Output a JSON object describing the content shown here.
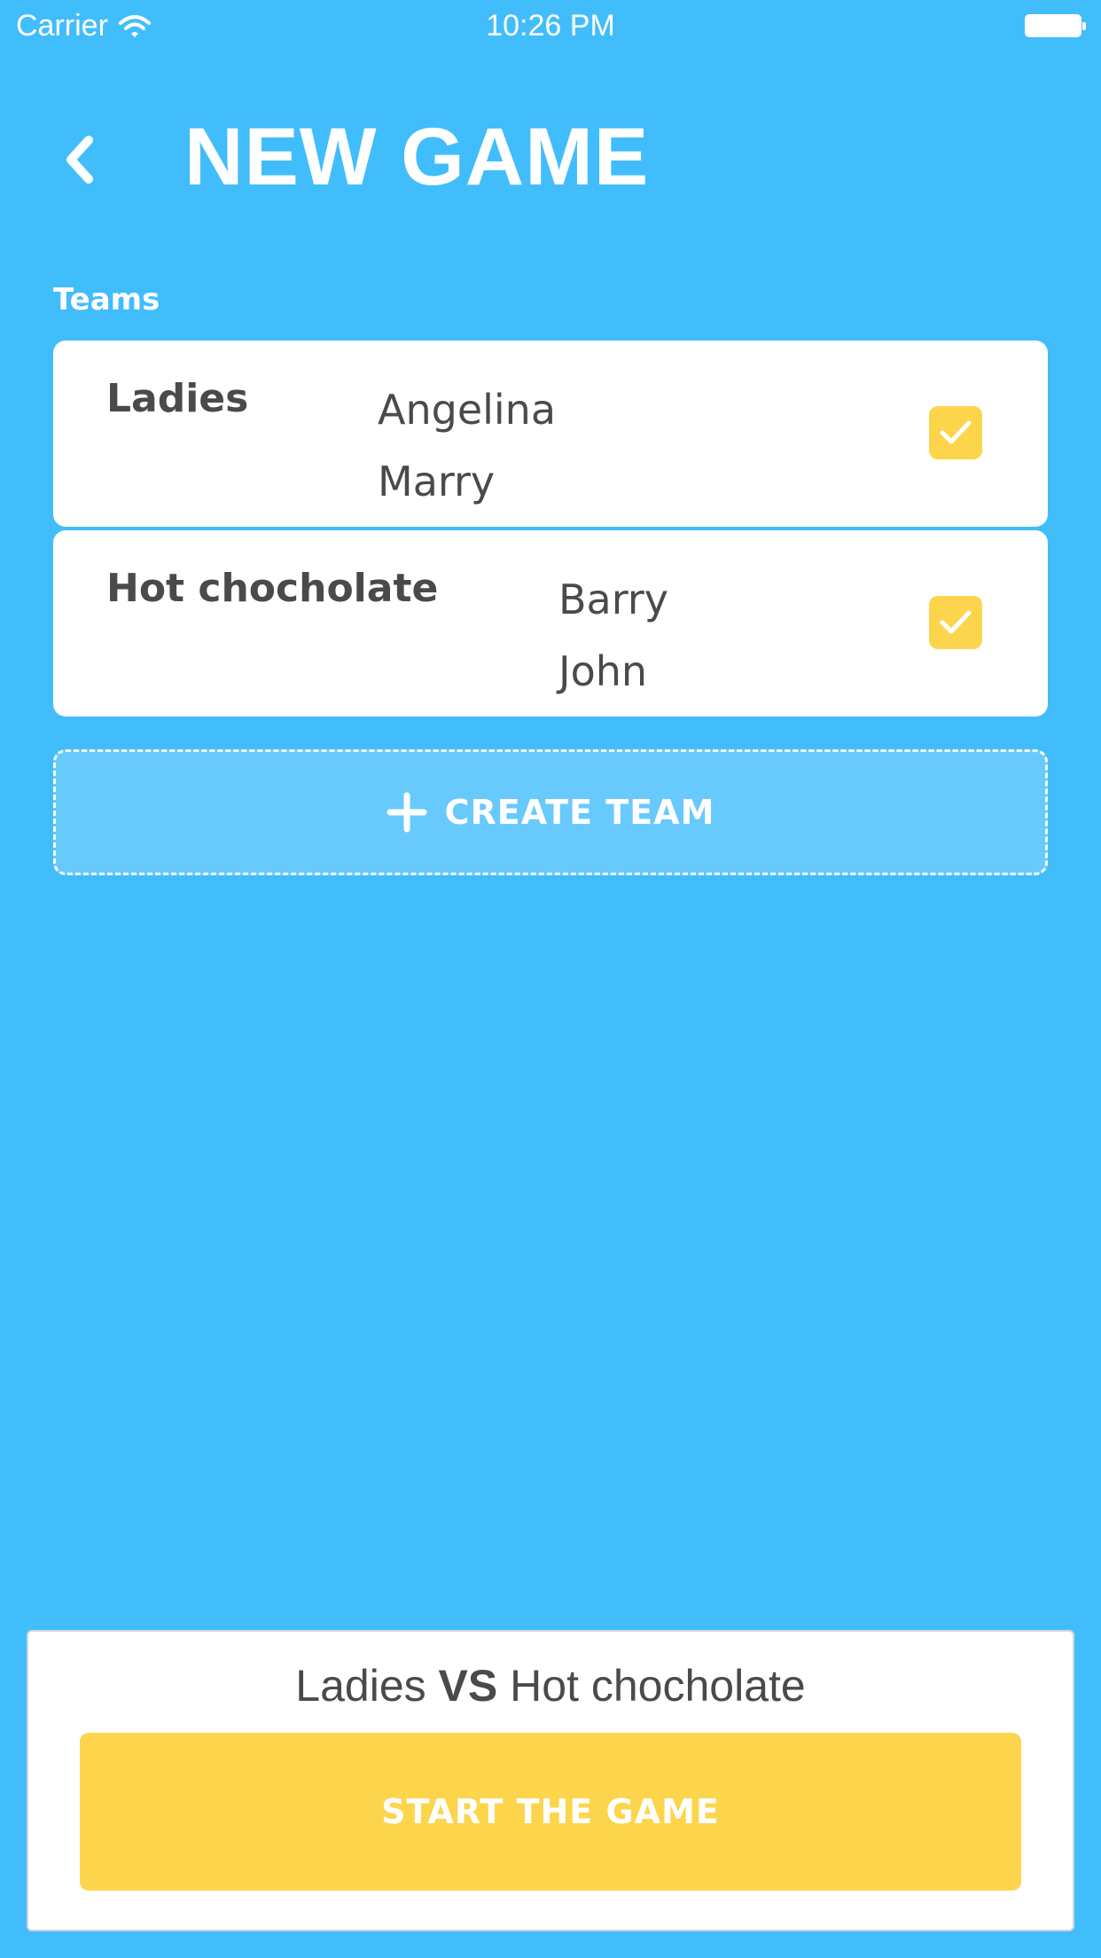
{
  "status_bar": {
    "carrier": "Carrier",
    "time": "10:26 PM"
  },
  "header": {
    "title": "NEW GAME"
  },
  "teams_section": {
    "label": "Teams",
    "teams": [
      {
        "name": "Ladies",
        "members": [
          "Angelina",
          "Marry"
        ],
        "selected": true
      },
      {
        "name": "Hot chocholate",
        "members": [
          "Barry",
          "John"
        ],
        "selected": true
      }
    ],
    "create_label": "CREATE TEAM"
  },
  "footer": {
    "team_a": "Ladies",
    "vs": "VS",
    "team_b": "Hot chocholate",
    "start_label": "START THE GAME"
  },
  "colors": {
    "background": "#42BDFC",
    "accent": "#FDD54C",
    "text_dark": "#4a4a4a"
  }
}
